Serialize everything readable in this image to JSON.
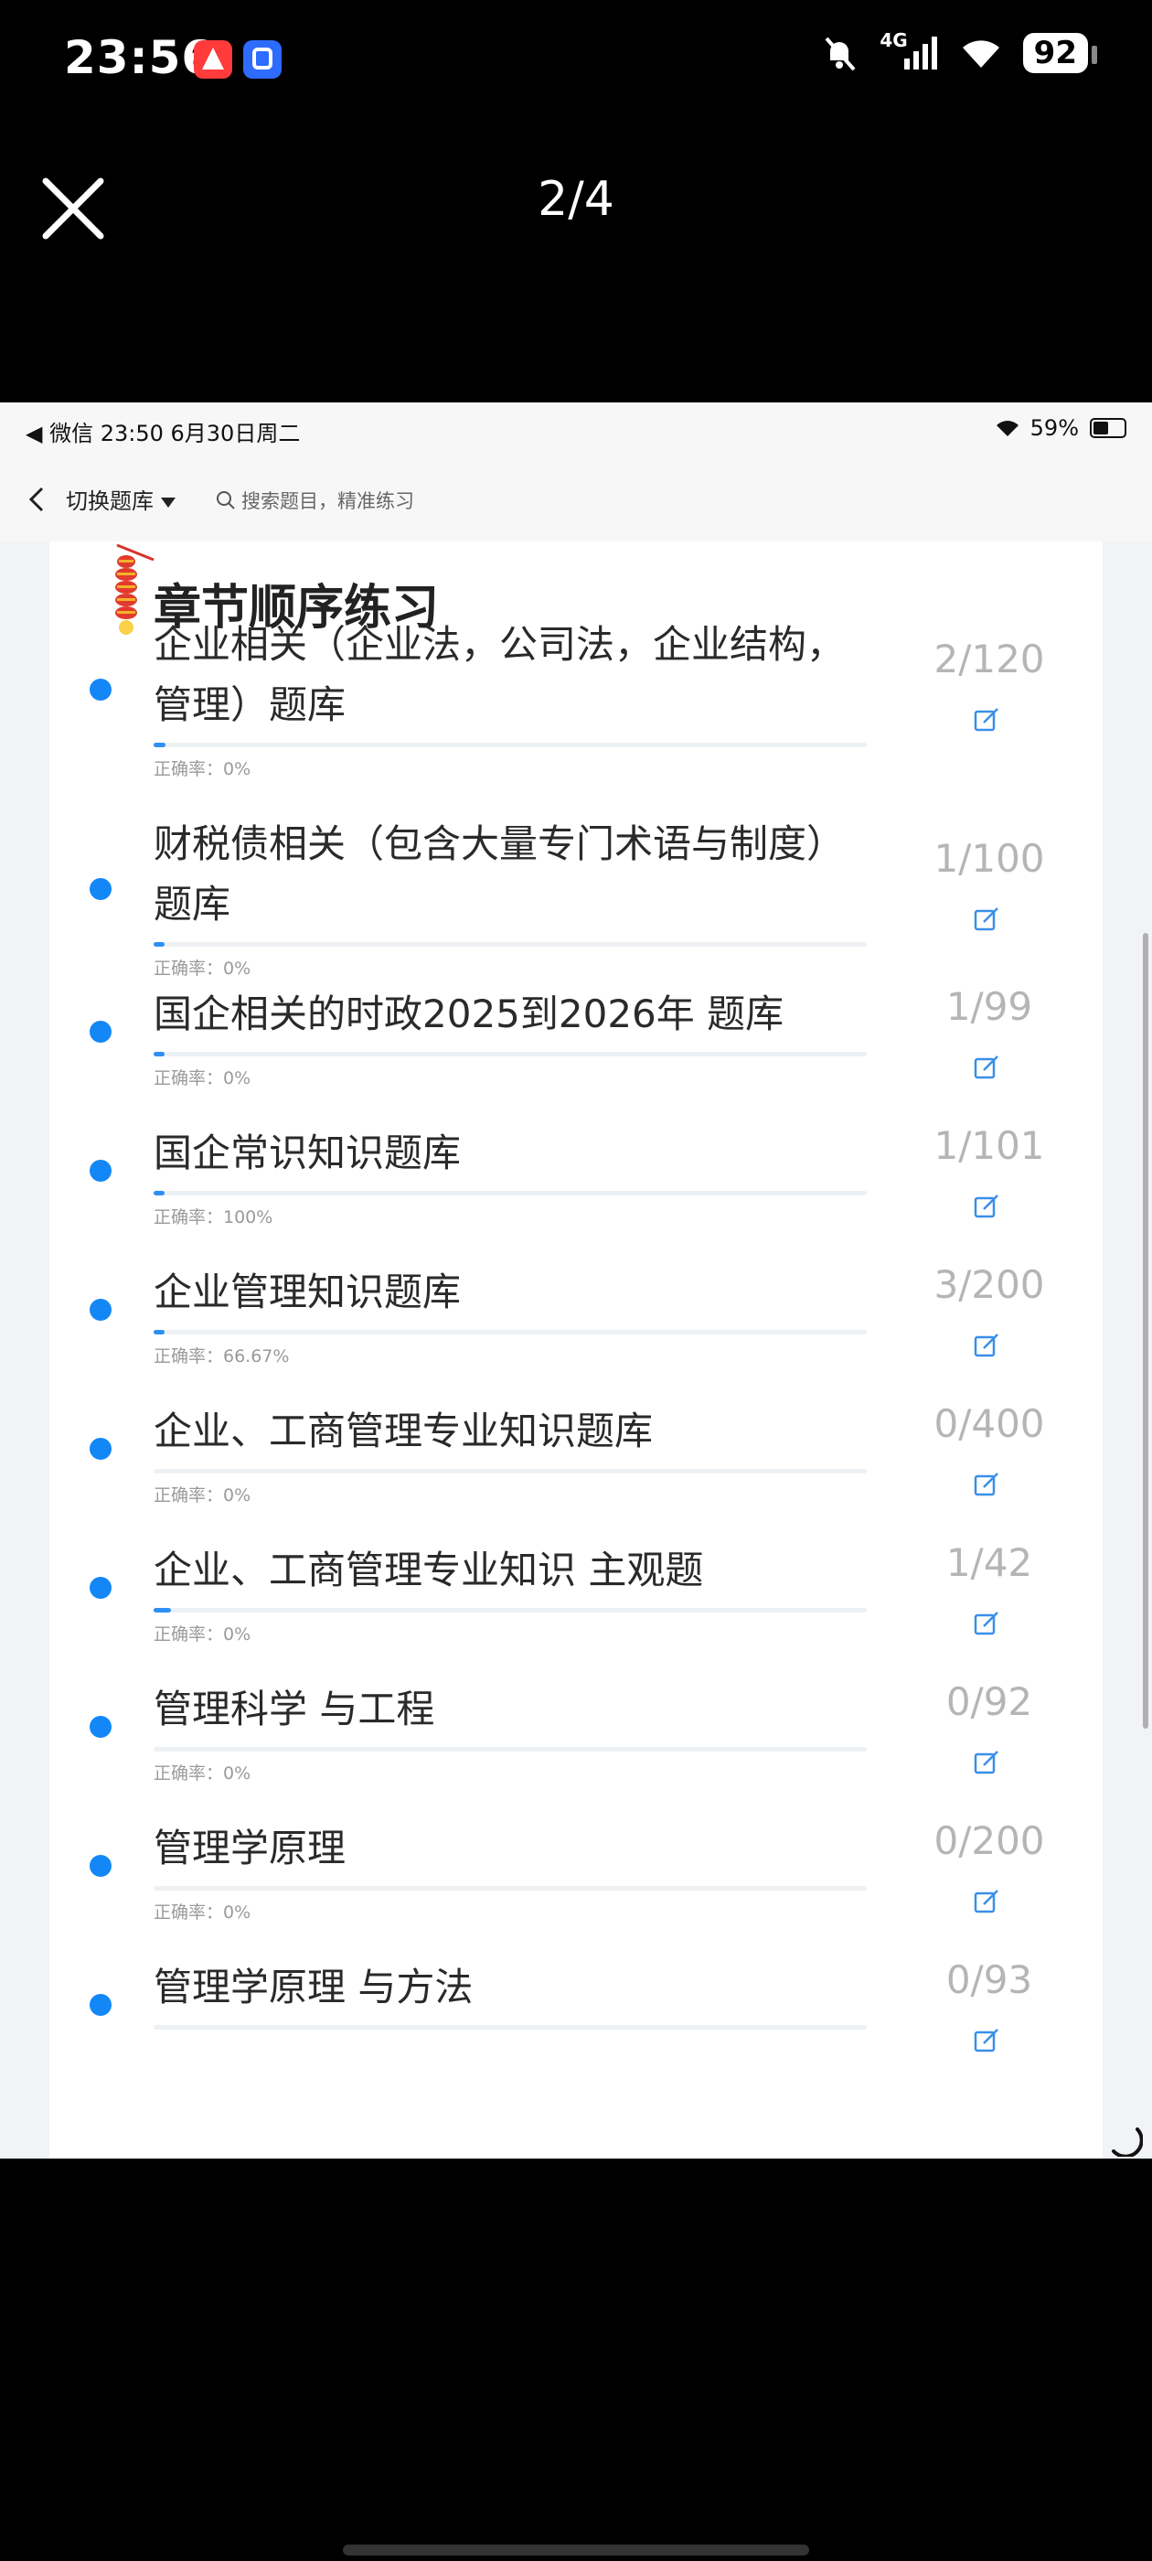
{
  "phone_status": {
    "time": "23:56",
    "network": "4G",
    "battery": "92"
  },
  "viewer": {
    "counter": "2/4"
  },
  "screenshot": {
    "status_left": "◀ 微信   23:50   6月30日周二",
    "status_battery": "59%",
    "nav": {
      "switch_label": "切换题库",
      "search_placeholder": "搜索题目，精准练习"
    },
    "section_title": "章节顺序练习",
    "items": [
      {
        "title": "企业相关（企业法，公司法，企业结构，管理）题库",
        "accuracy": "正确率：0%",
        "count": "2/120",
        "progress": 0.017
      },
      {
        "title": "财税债相关（包含大量专门术语与制度）题库",
        "accuracy": "正确率：0%",
        "count": "1/100",
        "progress": 0.01
      },
      {
        "title": "国企相关的时政2025到2026年 题库",
        "accuracy": "正确率：0%",
        "count": "1/99",
        "progress": 0.01
      },
      {
        "title": "国企常识知识题库",
        "accuracy": "正确率：100%",
        "count": "1/101",
        "progress": 0.01
      },
      {
        "title": "企业管理知识题库",
        "accuracy": "正确率：66.67%",
        "count": "3/200",
        "progress": 0.015
      },
      {
        "title": "企业、工商管理专业知识题库",
        "accuracy": "正确率：0%",
        "count": "0/400",
        "progress": 0
      },
      {
        "title": "企业、工商管理专业知识 主观题",
        "accuracy": "正确率：0%",
        "count": "1/42",
        "progress": 0.024
      },
      {
        "title": "管理科学 与工程",
        "accuracy": "正确率：0%",
        "count": "0/92",
        "progress": 0
      },
      {
        "title": "管理学原理",
        "accuracy": "正确率：0%",
        "count": "0/200",
        "progress": 0
      },
      {
        "title": "管理学原理 与方法",
        "accuracy": "",
        "count": "0/93",
        "progress": 0
      }
    ]
  },
  "colors": {
    "accent": "#1487f6",
    "count_gray": "#b5b5b5",
    "card_bg": "#ffffff"
  }
}
